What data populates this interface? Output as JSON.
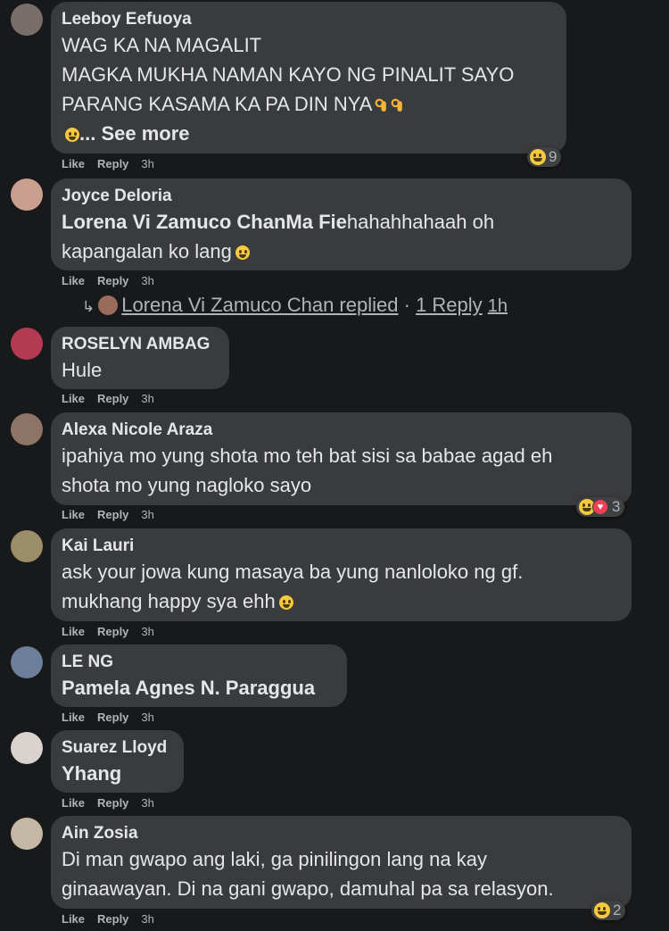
{
  "actions": {
    "like": "Like",
    "reply": "Reply"
  },
  "comments": [
    {
      "author": "Leeboy Eefuoya",
      "lines": [
        "WAG KA NA MAGALIT",
        "MAGKA MUKHA NAMAN KAYO NG PINALIT SAYO",
        "PARANG KASAMA KA PA DIN NYA"
      ],
      "see_more": "... See more",
      "time": "3h",
      "reaction_count": "9",
      "avatar_color": "#7a6e6a"
    },
    {
      "author": "Joyce Deloria",
      "tag": "Lorena Vi Zamuco ChanMa Fie",
      "text_after_tag": "hahahhahaah oh",
      "line2": "kapangalan ko lang",
      "time": "3h",
      "reply_summary": {
        "name": "Lorena Vi Zamuco Chan replied",
        "sep": "·",
        "count": "1 Reply",
        "time": "1h"
      },
      "avatar_color": "#c9a08f"
    },
    {
      "author": "ROSELYN AMBAG",
      "text": "Hule",
      "time": "3h",
      "avatar_color": "#b23b52"
    },
    {
      "author": "Alexa Nicole Araza",
      "text": "ipahiya mo yung shota mo teh bat sisi sa babae agad eh\nshota mo yung nagloko sayo",
      "time": "3h",
      "reaction_count": "3",
      "avatar_color": "#8e7467"
    },
    {
      "author": "Kai Lauri",
      "line1": "ask your jowa kung masaya ba yung nanloloko ng gf.",
      "line2": "mukhang happy sya ehh",
      "time": "3h",
      "avatar_color": "#9c8e6a"
    },
    {
      "author": "LE NG",
      "tag": "Pamela Agnes N. Paraggua",
      "time": "3h",
      "avatar_color": "#6c7e9a"
    },
    {
      "author": "Suarez Lloyd",
      "tag": "Yhang",
      "time": "3h",
      "avatar_color": "#d9d2cf"
    },
    {
      "author": "Ain Zosia",
      "text": "Di man gwapo ang laki, ga pinilingon lang na kay\nginaawayan. Di na gani gwapo, damuhal pa sa relasyon.",
      "time": "3h",
      "reaction_count": "2",
      "avatar_color": "#c4b7a4"
    }
  ]
}
